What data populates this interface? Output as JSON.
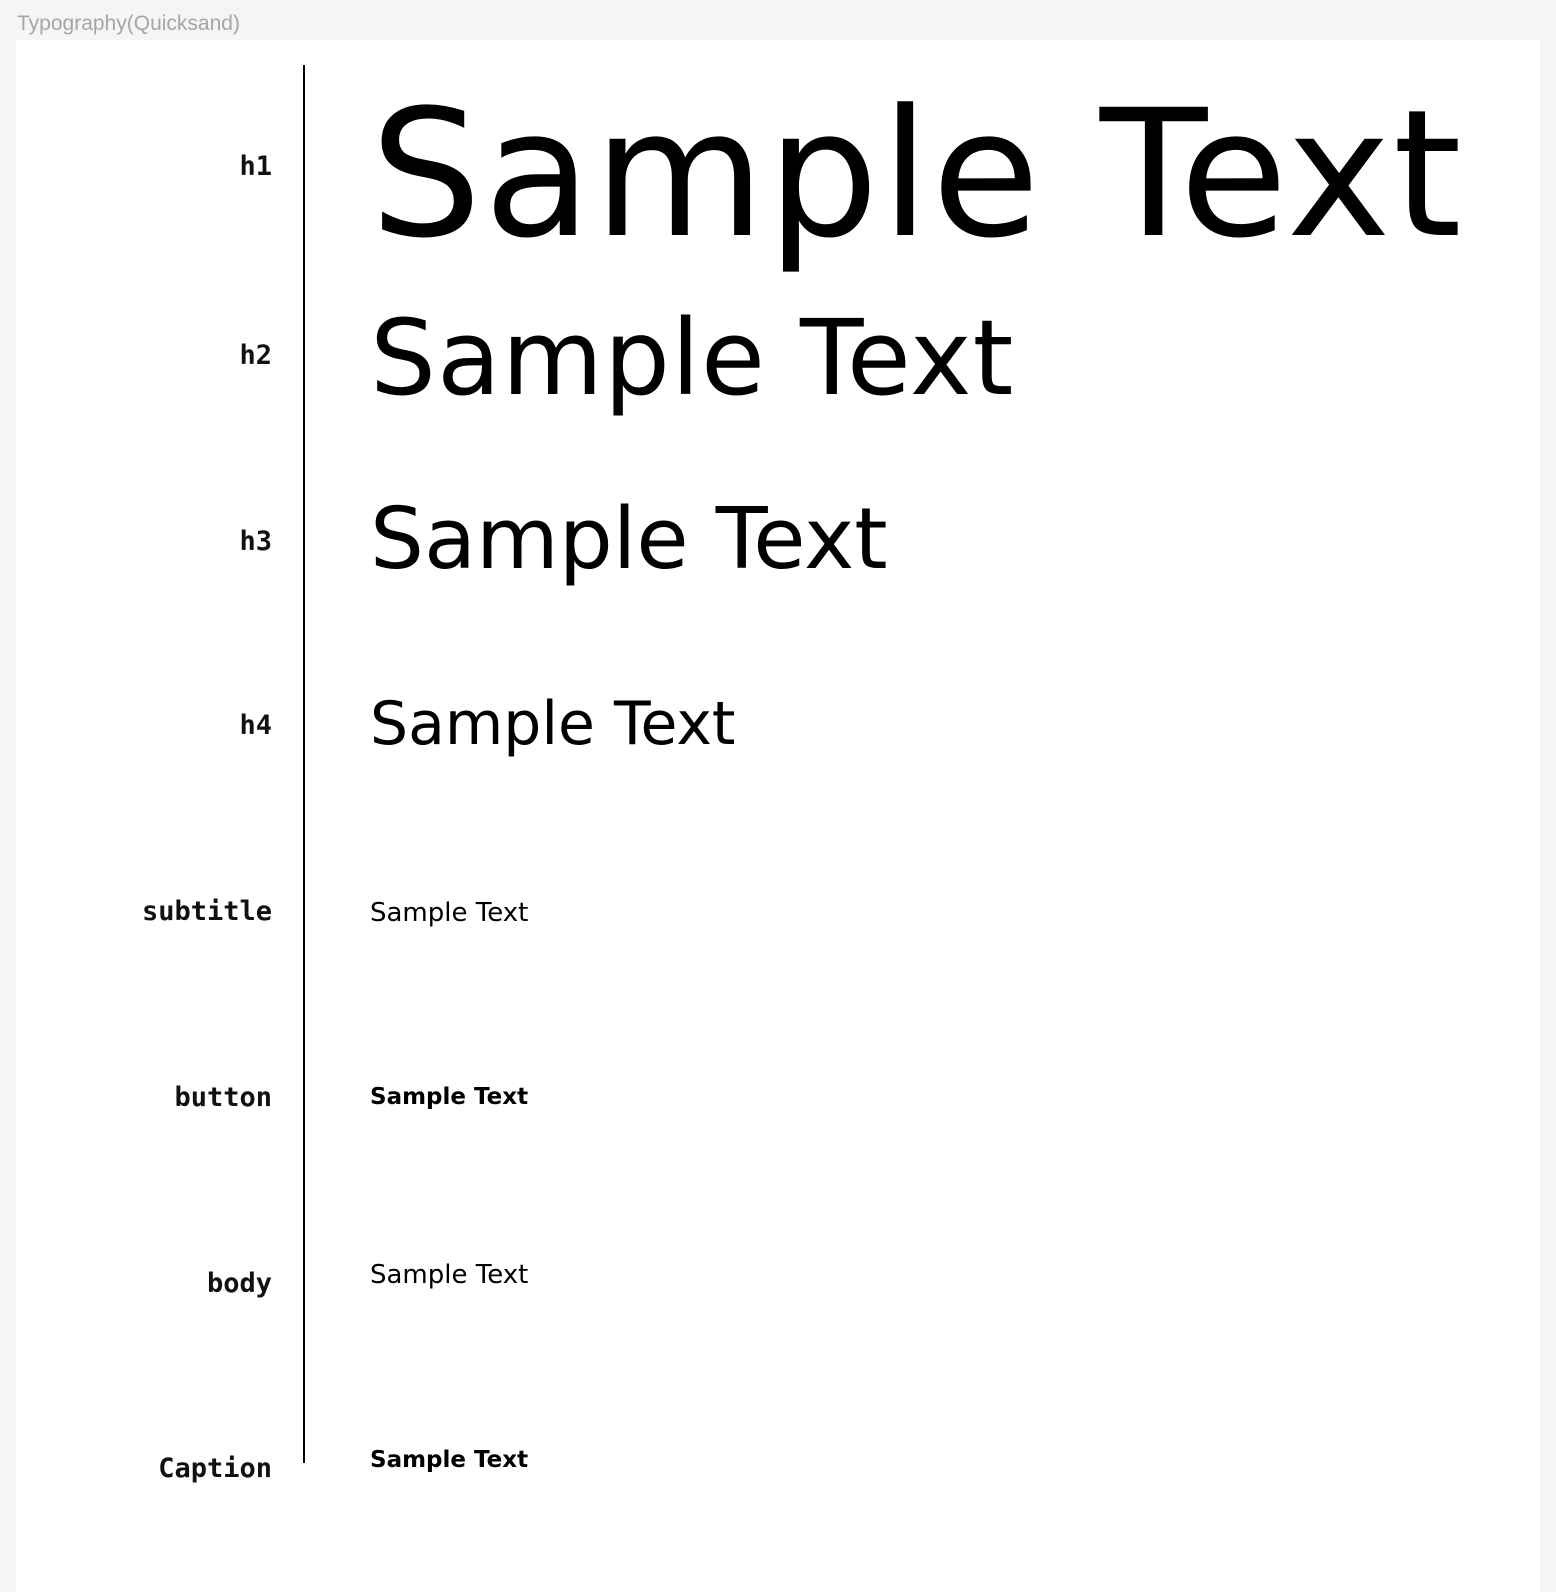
{
  "frame": {
    "title": "Typography(Quicksand)"
  },
  "rows": [
    {
      "label": "h1",
      "sample": "Sample Text"
    },
    {
      "label": "h2",
      "sample": "Sample Text"
    },
    {
      "label": "h3",
      "sample": "Sample Text"
    },
    {
      "label": "h4",
      "sample": "Sample Text"
    },
    {
      "label": "subtitle",
      "sample": "Sample Text"
    },
    {
      "label": "button",
      "sample": "Sample Text"
    },
    {
      "label": "body",
      "sample": "Sample Text"
    },
    {
      "label": "Caption",
      "sample": "Sample Text"
    }
  ],
  "colors": {
    "page_background": "#f5f5f5",
    "canvas_background": "#ffffff",
    "frame_title": "#a6a6a6",
    "text": "#000000"
  }
}
